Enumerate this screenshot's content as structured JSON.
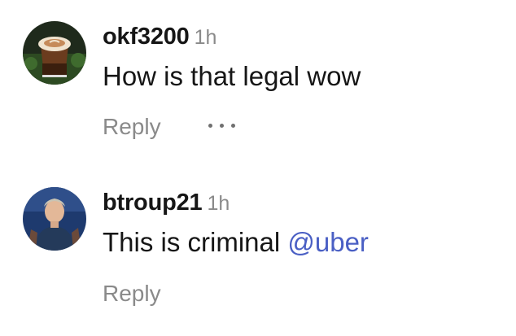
{
  "comments": [
    {
      "username": "okf3200",
      "time": "1h",
      "text": "How is that legal wow",
      "mention": "",
      "reply_label": "Reply",
      "avatar_icon": "coffee-avatar",
      "has_more_menu": true
    },
    {
      "username": "btroup21",
      "time": "1h",
      "text": "This is criminal ",
      "mention": "@uber",
      "reply_label": "Reply",
      "avatar_icon": "person-avatar",
      "has_more_menu": false
    }
  ],
  "colors": {
    "mention": "#4a5fc4",
    "muted": "#8a8a8a",
    "text": "#161616"
  }
}
